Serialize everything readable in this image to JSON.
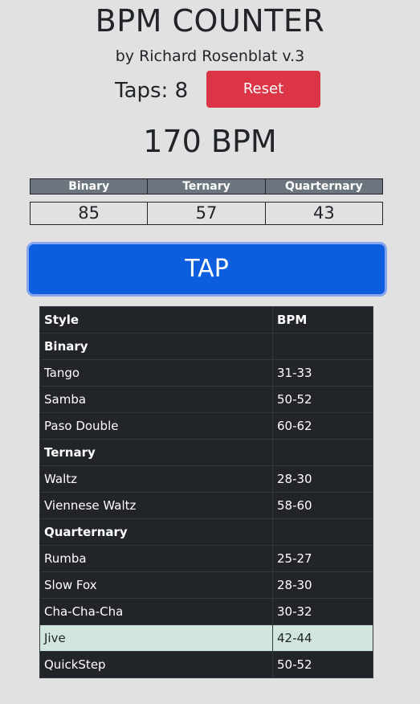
{
  "header": {
    "title": "BPM COUNTER",
    "subtitle": "by Richard Rosenblat v.3"
  },
  "counter": {
    "taps_label": "Taps: 8",
    "reset_label": "Reset",
    "bpm_label": "170 BPM"
  },
  "meters": {
    "headers": [
      "Binary",
      "Ternary",
      "Quarternary"
    ],
    "values": [
      "85",
      "57",
      "43"
    ]
  },
  "tap_button": {
    "label": "TAP"
  },
  "style_table": {
    "headers": {
      "style": "Style",
      "bpm": "BPM"
    },
    "rows": [
      {
        "style": "Binary",
        "bpm": ""
      },
      {
        "style": "Tango",
        "bpm": "31-33"
      },
      {
        "style": "Samba",
        "bpm": "50-52"
      },
      {
        "style": "Paso Double",
        "bpm": "60-62"
      },
      {
        "style": "Ternary",
        "bpm": ""
      },
      {
        "style": "Waltz",
        "bpm": "28-30"
      },
      {
        "style": "Viennese Waltz",
        "bpm": "58-60"
      },
      {
        "style": "Quarternary",
        "bpm": ""
      },
      {
        "style": "Rumba",
        "bpm": "25-27"
      },
      {
        "style": "Slow Fox",
        "bpm": "28-30"
      },
      {
        "style": "Cha-Cha-Cha",
        "bpm": "30-32"
      },
      {
        "style": "Jive",
        "bpm": "42-44"
      },
      {
        "style": "QuickStep",
        "bpm": "50-52"
      }
    ]
  },
  "colors": {
    "background": "#e1e1e1",
    "reset_button": "#dc3545",
    "tap_button": "#0d5ede",
    "table_dark": "#212529",
    "highlight_row": "#d1e7dd",
    "meter_header": "#6c757d"
  }
}
